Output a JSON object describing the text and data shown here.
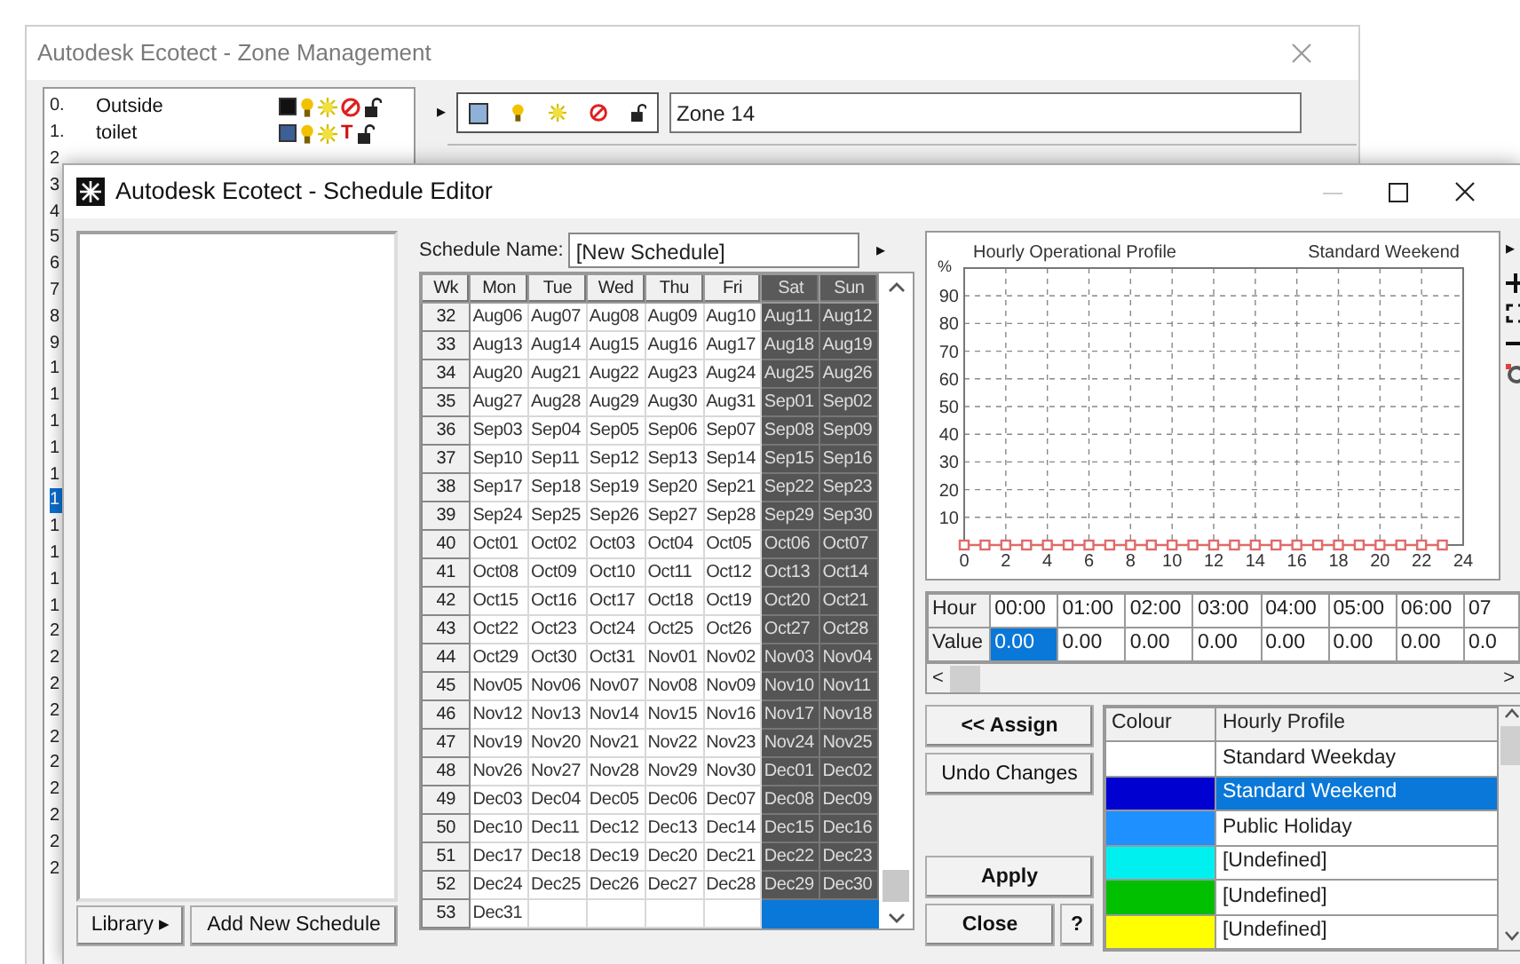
{
  "background_window": {
    "title": "Autodesk Ecotect - Zone Management",
    "zones": [
      {
        "number": "0.",
        "name": "Outside",
        "color": "#111111",
        "flag": {
          "kind": "prohibit"
        }
      },
      {
        "number": "1.",
        "name": "toilet",
        "color": "#3d5f95",
        "flag": {
          "kind": "letter",
          "text": "T"
        }
      }
    ],
    "row_numbers": [
      {
        "label": "2",
        "selected": false
      },
      {
        "label": "3",
        "selected": false
      },
      {
        "label": "4",
        "selected": false
      },
      {
        "label": "5",
        "selected": false
      },
      {
        "label": "6",
        "selected": false
      },
      {
        "label": "7",
        "selected": false
      },
      {
        "label": "8",
        "selected": false
      },
      {
        "label": "9",
        "selected": false
      },
      {
        "label": "1",
        "selected": false
      },
      {
        "label": "1",
        "selected": false
      },
      {
        "label": "1",
        "selected": false
      },
      {
        "label": "1",
        "selected": false
      },
      {
        "label": "1",
        "selected": false
      },
      {
        "label": "1",
        "selected": true
      },
      {
        "label": "1",
        "selected": false
      },
      {
        "label": "1",
        "selected": false
      },
      {
        "label": "1",
        "selected": false
      },
      {
        "label": "1",
        "selected": false
      },
      {
        "label": "2",
        "selected": false
      },
      {
        "label": "2",
        "selected": false
      },
      {
        "label": "2",
        "selected": false
      },
      {
        "label": "2",
        "selected": false
      },
      {
        "label": "2",
        "selected": false
      },
      {
        "label": "2",
        "selected": false
      },
      {
        "label": "2",
        "selected": false
      },
      {
        "label": "2",
        "selected": false
      },
      {
        "label": "2",
        "selected": false
      },
      {
        "label": "2",
        "selected": false
      }
    ],
    "current_zone": {
      "arrow": "▸",
      "color": "#8fb0d8",
      "name": "Zone 14"
    }
  },
  "window": {
    "title": "Autodesk Ecotect - Schedule Editor"
  },
  "library_button": "Library ▸",
  "add_button": "Add New Schedule",
  "schedule_name": {
    "label": "Schedule Name:",
    "value": "[New Schedule]",
    "arrow": "▸"
  },
  "calendar": {
    "columns": [
      {
        "label": "Wk",
        "weekend": false
      },
      {
        "label": "Mon",
        "weekend": false
      },
      {
        "label": "Tue",
        "weekend": false
      },
      {
        "label": "Wed",
        "weekend": false
      },
      {
        "label": "Thu",
        "weekend": false
      },
      {
        "label": "Fri",
        "weekend": false
      },
      {
        "label": "Sat",
        "weekend": true
      },
      {
        "label": "Sun",
        "weekend": true
      }
    ],
    "rows": [
      {
        "week": "32",
        "days": [
          "Aug06",
          "Aug07",
          "Aug08",
          "Aug09",
          "Aug10",
          "Aug11",
          "Aug12"
        ],
        "selected": false
      },
      {
        "week": "33",
        "days": [
          "Aug13",
          "Aug14",
          "Aug15",
          "Aug16",
          "Aug17",
          "Aug18",
          "Aug19"
        ],
        "selected": false
      },
      {
        "week": "34",
        "days": [
          "Aug20",
          "Aug21",
          "Aug22",
          "Aug23",
          "Aug24",
          "Aug25",
          "Aug26"
        ],
        "selected": false
      },
      {
        "week": "35",
        "days": [
          "Aug27",
          "Aug28",
          "Aug29",
          "Aug30",
          "Aug31",
          "Sep01",
          "Sep02"
        ],
        "selected": false
      },
      {
        "week": "36",
        "days": [
          "Sep03",
          "Sep04",
          "Sep05",
          "Sep06",
          "Sep07",
          "Sep08",
          "Sep09"
        ],
        "selected": false
      },
      {
        "week": "37",
        "days": [
          "Sep10",
          "Sep11",
          "Sep12",
          "Sep13",
          "Sep14",
          "Sep15",
          "Sep16"
        ],
        "selected": false
      },
      {
        "week": "38",
        "days": [
          "Sep17",
          "Sep18",
          "Sep19",
          "Sep20",
          "Sep21",
          "Sep22",
          "Sep23"
        ],
        "selected": false
      },
      {
        "week": "39",
        "days": [
          "Sep24",
          "Sep25",
          "Sep26",
          "Sep27",
          "Sep28",
          "Sep29",
          "Sep30"
        ],
        "selected": false
      },
      {
        "week": "40",
        "days": [
          "Oct01",
          "Oct02",
          "Oct03",
          "Oct04",
          "Oct05",
          "Oct06",
          "Oct07"
        ],
        "selected": false
      },
      {
        "week": "41",
        "days": [
          "Oct08",
          "Oct09",
          "Oct10",
          "Oct11",
          "Oct12",
          "Oct13",
          "Oct14"
        ],
        "selected": false
      },
      {
        "week": "42",
        "days": [
          "Oct15",
          "Oct16",
          "Oct17",
          "Oct18",
          "Oct19",
          "Oct20",
          "Oct21"
        ],
        "selected": false
      },
      {
        "week": "43",
        "days": [
          "Oct22",
          "Oct23",
          "Oct24",
          "Oct25",
          "Oct26",
          "Oct27",
          "Oct28"
        ],
        "selected": false
      },
      {
        "week": "44",
        "days": [
          "Oct29",
          "Oct30",
          "Oct31",
          "Nov01",
          "Nov02",
          "Nov03",
          "Nov04"
        ],
        "selected": false
      },
      {
        "week": "45",
        "days": [
          "Nov05",
          "Nov06",
          "Nov07",
          "Nov08",
          "Nov09",
          "Nov10",
          "Nov11"
        ],
        "selected": false
      },
      {
        "week": "46",
        "days": [
          "Nov12",
          "Nov13",
          "Nov14",
          "Nov15",
          "Nov16",
          "Nov17",
          "Nov18"
        ],
        "selected": false
      },
      {
        "week": "47",
        "days": [
          "Nov19",
          "Nov20",
          "Nov21",
          "Nov22",
          "Nov23",
          "Nov24",
          "Nov25"
        ],
        "selected": false
      },
      {
        "week": "48",
        "days": [
          "Nov26",
          "Nov27",
          "Nov28",
          "Nov29",
          "Nov30",
          "Dec01",
          "Dec02"
        ],
        "selected": false
      },
      {
        "week": "49",
        "days": [
          "Dec03",
          "Dec04",
          "Dec05",
          "Dec06",
          "Dec07",
          "Dec08",
          "Dec09"
        ],
        "selected": false
      },
      {
        "week": "50",
        "days": [
          "Dec10",
          "Dec11",
          "Dec12",
          "Dec13",
          "Dec14",
          "Dec15",
          "Dec16"
        ],
        "selected": false
      },
      {
        "week": "51",
        "days": [
          "Dec17",
          "Dec18",
          "Dec19",
          "Dec20",
          "Dec21",
          "Dec22",
          "Dec23"
        ],
        "selected": false
      },
      {
        "week": "52",
        "days": [
          "Dec24",
          "Dec25",
          "Dec26",
          "Dec27",
          "Dec28",
          "Dec29",
          "Dec30"
        ],
        "selected": false
      },
      {
        "week": "53",
        "days": [
          "Dec31"
        ],
        "selected": true
      }
    ]
  },
  "chart": {
    "menu_arrow": "▸",
    "chart_data": {
      "type": "line",
      "title": "Hourly Operational Profile",
      "ylabel": "%",
      "grid": true,
      "xlim": [
        0,
        24
      ],
      "ylim": [
        0,
        100
      ],
      "xticks": [
        0,
        2,
        4,
        6,
        8,
        10,
        12,
        14,
        16,
        18,
        20,
        22,
        24
      ],
      "yticks": [
        10,
        20,
        30,
        40,
        50,
        60,
        70,
        80,
        90
      ],
      "x": [
        0,
        1,
        2,
        3,
        4,
        5,
        6,
        7,
        8,
        9,
        10,
        11,
        12,
        13,
        14,
        15,
        16,
        17,
        18,
        19,
        20,
        21,
        22,
        23
      ],
      "series": [
        {
          "name": "Standard Weekend",
          "color": "#e06a6a",
          "marker": "square",
          "values": [
            0,
            0,
            0,
            0,
            0,
            0,
            0,
            0,
            0,
            0,
            0,
            0,
            0,
            0,
            0,
            0,
            0,
            0,
            0,
            0,
            0,
            0,
            0,
            0
          ]
        }
      ]
    }
  },
  "hourly_table": {
    "hour_label": "Hour",
    "value_label": "Value",
    "hours": [
      "00:00",
      "01:00",
      "02:00",
      "03:00",
      "04:00",
      "05:00",
      "06:00",
      "07"
    ],
    "values": [
      {
        "text": "0.00",
        "selected": true
      },
      {
        "text": "0.00",
        "selected": false
      },
      {
        "text": "0.00",
        "selected": false
      },
      {
        "text": "0.00",
        "selected": false
      },
      {
        "text": "0.00",
        "selected": false
      },
      {
        "text": "0.00",
        "selected": false
      },
      {
        "text": "0.00",
        "selected": false
      },
      {
        "text": "0.0",
        "selected": false
      }
    ],
    "scroll_left": "<",
    "scroll_right": ">"
  },
  "buttons": {
    "assign": "<< Assign",
    "undo": "Undo Changes",
    "apply": "Apply",
    "close": "Close",
    "help": "?"
  },
  "profiles": {
    "columns": [
      "Colour",
      "Hourly Profile"
    ],
    "rows": [
      {
        "name": "Standard Weekday",
        "color": "#ffffff",
        "selected": false
      },
      {
        "name": "Standard Weekend",
        "color": "#0000d0",
        "selected": true
      },
      {
        "name": "Public Holiday",
        "color": "#1e90ff",
        "selected": false
      },
      {
        "name": "[Undefined]",
        "color": "#00f0f0",
        "selected": false
      },
      {
        "name": "[Undefined]",
        "color": "#00c000",
        "selected": false
      },
      {
        "name": "[Undefined]",
        "color": "#ffff00",
        "selected": false
      }
    ]
  }
}
